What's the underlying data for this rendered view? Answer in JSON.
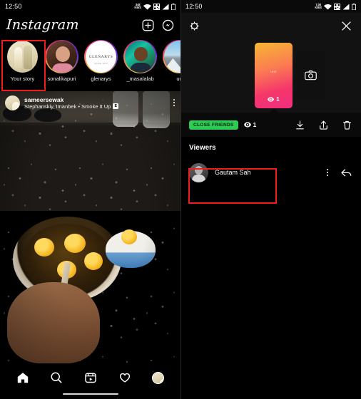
{
  "left": {
    "status": {
      "time": "12:50",
      "data_rate_value": "348",
      "data_rate_unit": "KB/S",
      "icons": [
        "wifi-icon",
        "qr-signal-icon",
        "cellular-signal-icon",
        "battery-icon"
      ]
    },
    "appbar": {
      "logo": "Instagram",
      "add_icon": "plus-square-icon",
      "messenger_icon": "messenger-icon"
    },
    "stories": [
      {
        "name": "Your story",
        "ring": "none",
        "art": "av-wedding",
        "highlighted": true
      },
      {
        "name": "sonalikapuri",
        "ring": "gradient",
        "art": "av-girl",
        "highlighted": false
      },
      {
        "name": "glenarys",
        "ring": "gradient",
        "art": "av-logo",
        "logo_text": "GLENARYS",
        "logo_sub": "SINCE 1870",
        "highlighted": false
      },
      {
        "name": "_masalalab",
        "ring": "gradient",
        "art": "av-man",
        "highlighted": false
      },
      {
        "name": "ud",
        "ring": "gradient",
        "art": "av-mtn",
        "highlighted": false
      }
    ],
    "post": {
      "username": "sameersewak",
      "audio": "Stephanskiy, Imanbek • Smoke It Up",
      "explicit_badge": "E",
      "more_icon": "more-options-icon",
      "media_description": "kitchen-counter-eggs-in-pot-video"
    },
    "bottom_nav": [
      {
        "name": "home-tab",
        "icon": "home-icon",
        "active": true
      },
      {
        "name": "search-tab",
        "icon": "search-icon",
        "active": false
      },
      {
        "name": "reels-tab",
        "icon": "reels-icon",
        "active": false
      },
      {
        "name": "activity-tab",
        "icon": "heart-icon",
        "active": false
      },
      {
        "name": "profile-tab",
        "icon": "profile-avatar",
        "active": false
      }
    ]
  },
  "right": {
    "status": {
      "time": "12:50",
      "data_rate_value": "7.00",
      "data_rate_unit": "KB/S"
    },
    "topbar": {
      "settings_icon": "story-settings-icon",
      "close_icon": "close-icon"
    },
    "story_card": {
      "text": "test",
      "views": "1",
      "views_icon": "eye-icon"
    },
    "camera_tile": {
      "icon": "camera-icon"
    },
    "actions": {
      "close_friends_label": "CLOSE FRIENDS",
      "views_icon": "eye-icon",
      "views": "1",
      "save_icon": "download-icon",
      "share_icon": "share-icon",
      "delete_icon": "trash-icon"
    },
    "viewers": {
      "title": "Viewers",
      "list": [
        {
          "name": "Gautam Sah",
          "more_icon": "more-options-icon",
          "reply_icon": "reply-arrow-icon",
          "highlighted": true
        }
      ]
    }
  },
  "highlights": {
    "color": "#ef1d1d"
  }
}
